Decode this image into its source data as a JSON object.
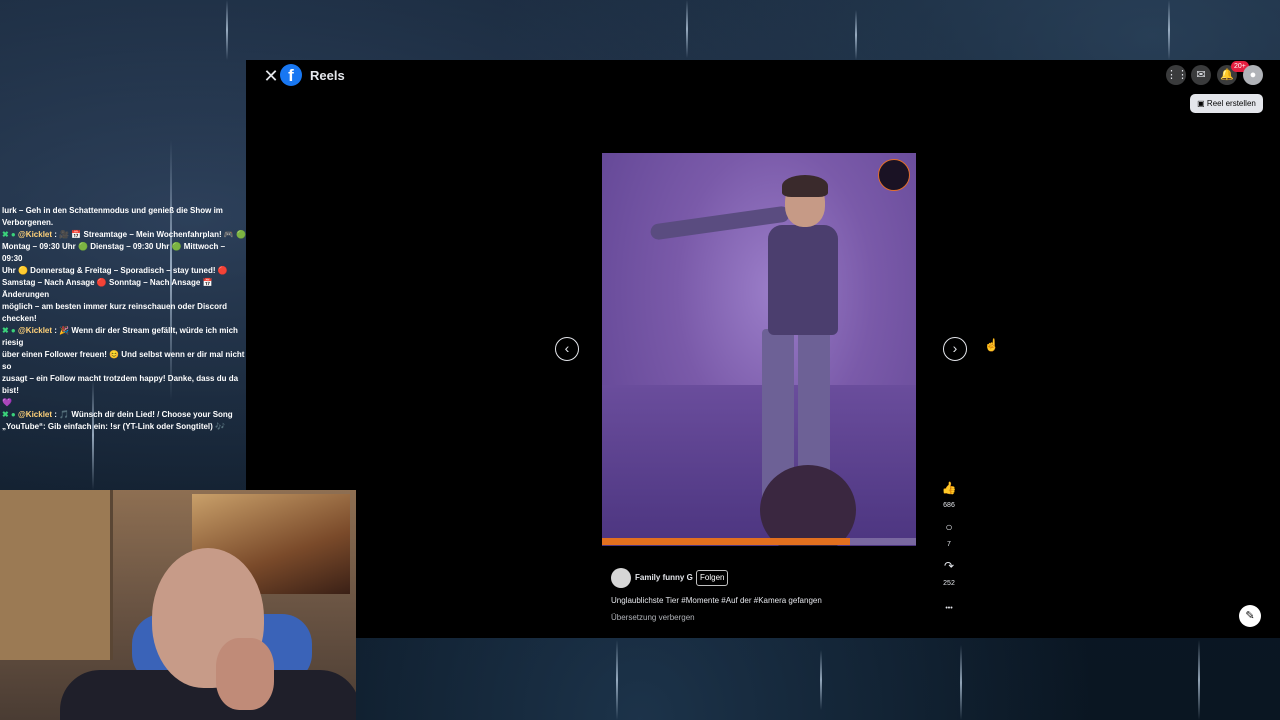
{
  "viewer": {
    "close_label": "✕",
    "logo_glyph": "f",
    "title": "Reels",
    "notification_badge": "20+",
    "create_reel_label": "Reel erstellen",
    "icons": [
      "grid-menu-icon",
      "messenger-icon",
      "bell-icon",
      "profile-icon"
    ]
  },
  "reel": {
    "progress_percent": 79,
    "prev_glyph": "‹",
    "next_glyph": "›",
    "likes": "686",
    "comments": "7",
    "shares": "252",
    "more_glyph": "•••",
    "author": "Family funny G",
    "follow_label": "Folgen",
    "caption": "Unglaublichste Tier #Momente #Auf der #Kamera gefangen",
    "translation_toggle": "Übersetzung verbergen"
  },
  "chat": {
    "messages": [
      {
        "prefix": "",
        "user": "",
        "text": "lurk – Geh in den Schattenmodus und genieß die Show im"
      },
      {
        "prefix": "",
        "user": "",
        "text": "Verborgenen."
      },
      {
        "prefix": "✖ ●",
        "user": "@Kicklet",
        "text": ": 🎥 📅 Streamtage – Mein Wochenfahrplan! 🎮 🟢"
      },
      {
        "prefix": "",
        "user": "",
        "text": "Montag – 09:30 Uhr 🟢 Dienstag – 09:30 Uhr 🟢 Mittwoch – 09:30"
      },
      {
        "prefix": "",
        "user": "",
        "text": "Uhr 🟡 Donnerstag & Freitag – Sporadisch – stay tuned! 🔴"
      },
      {
        "prefix": "",
        "user": "",
        "text": "Samstag – Nach Ansage 🔴 Sonntag – Nach Ansage 📅 Änderungen"
      },
      {
        "prefix": "",
        "user": "",
        "text": "möglich – am besten immer kurz reinschauen oder Discord checken!"
      },
      {
        "prefix": "✖ ●",
        "user": "@Kicklet",
        "text": ": 🎉 Wenn dir der Stream gefällt, würde ich mich riesig"
      },
      {
        "prefix": "",
        "user": "",
        "text": "über einen Follower freuen! 😊 Und selbst wenn er dir mal nicht so"
      },
      {
        "prefix": "",
        "user": "",
        "text": "zusagt – ein Follow macht trotzdem happy! Danke, dass du da bist!"
      },
      {
        "prefix": "",
        "user": "",
        "text": "💜"
      },
      {
        "prefix": "✖ ●",
        "user": "@Kicklet",
        "text": ": 🎵 Wünsch dir dein Lied! / Choose your Song"
      },
      {
        "prefix": "",
        "user": "",
        "text": "„YouTube“: Gib einfach ein: !sr (YT-Link oder Songtitel) 🎶"
      }
    ]
  }
}
